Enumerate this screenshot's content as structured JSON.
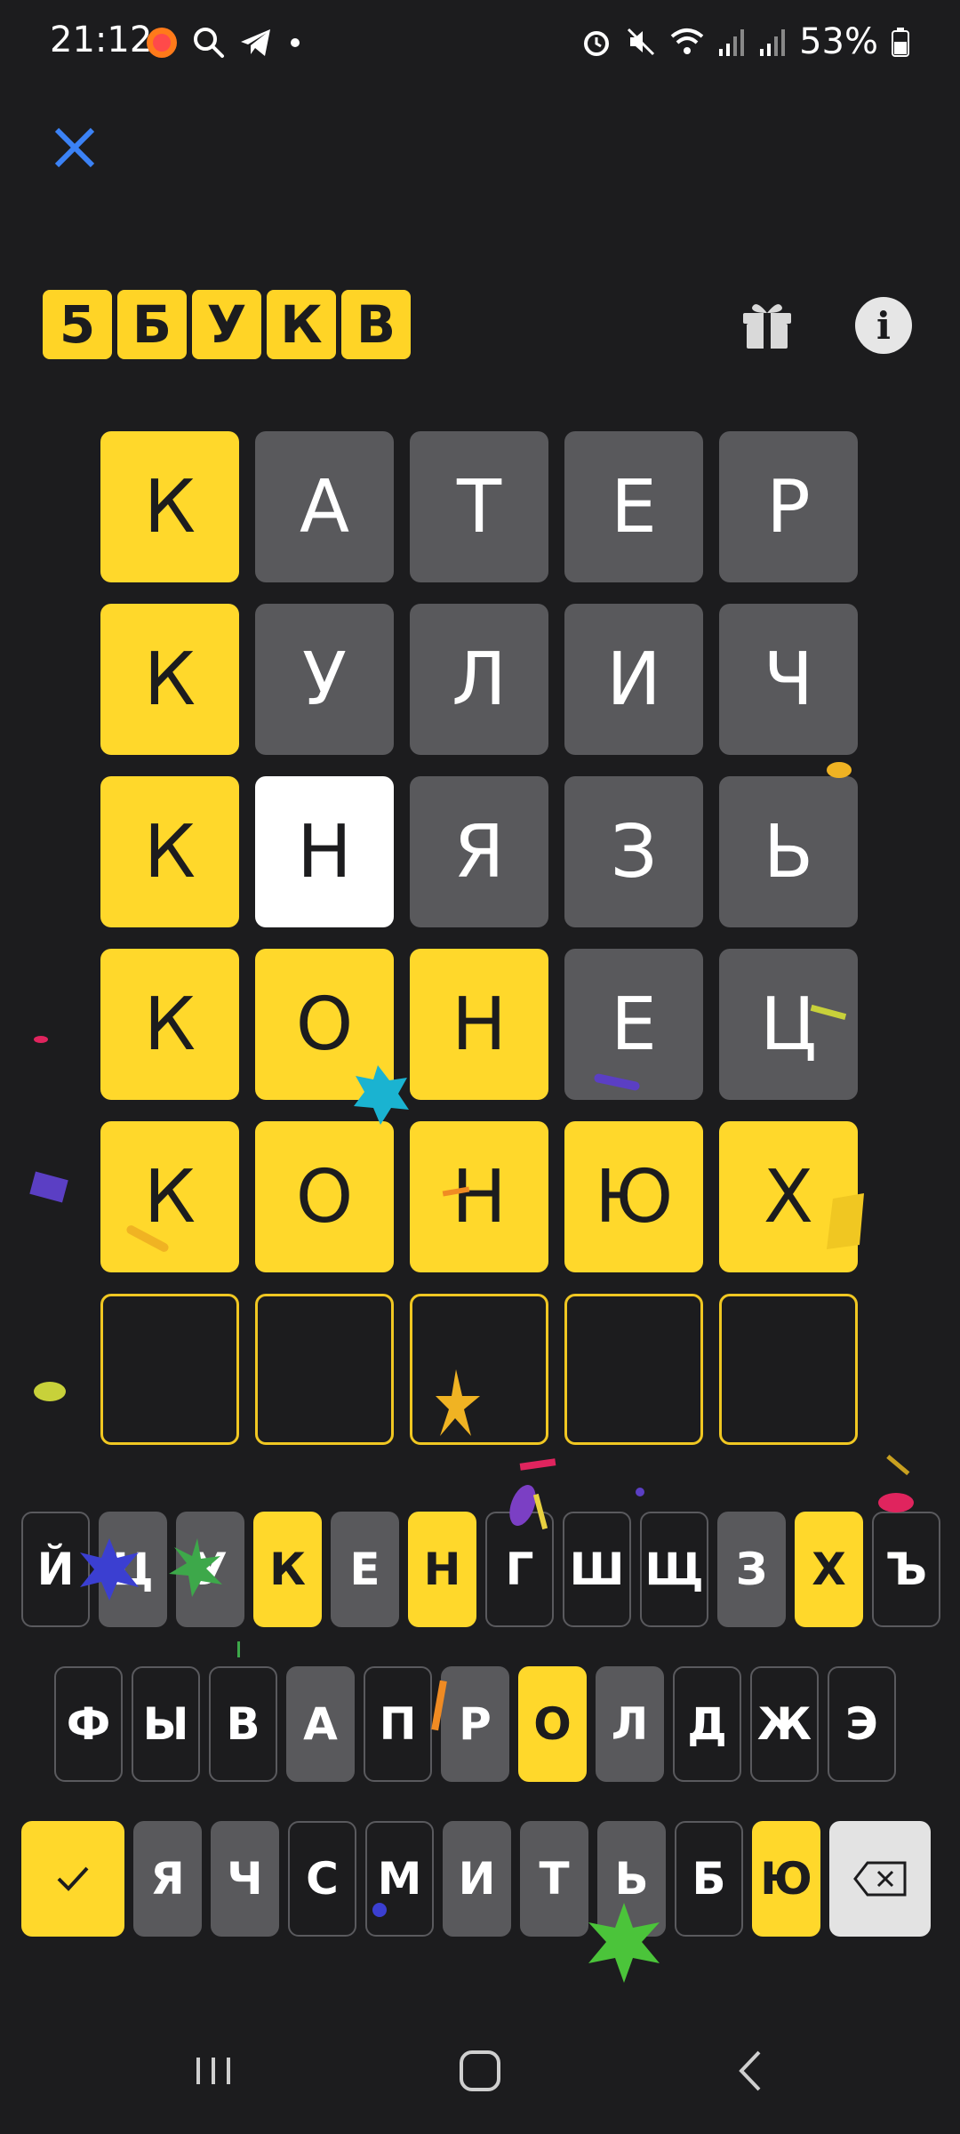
{
  "status_bar": {
    "time": "21:12",
    "battery": "53%"
  },
  "logo": {
    "letters": [
      "5",
      "Б",
      "У",
      "К",
      "В"
    ]
  },
  "board": {
    "rows": [
      [
        {
          "letter": "К",
          "state": "yellow"
        },
        {
          "letter": "А",
          "state": "gray"
        },
        {
          "letter": "Т",
          "state": "gray"
        },
        {
          "letter": "Е",
          "state": "gray"
        },
        {
          "letter": "Р",
          "state": "gray"
        }
      ],
      [
        {
          "letter": "К",
          "state": "yellow"
        },
        {
          "letter": "У",
          "state": "gray"
        },
        {
          "letter": "Л",
          "state": "gray"
        },
        {
          "letter": "И",
          "state": "gray"
        },
        {
          "letter": "Ч",
          "state": "gray"
        }
      ],
      [
        {
          "letter": "К",
          "state": "yellow"
        },
        {
          "letter": "Н",
          "state": "white"
        },
        {
          "letter": "Я",
          "state": "gray"
        },
        {
          "letter": "З",
          "state": "gray"
        },
        {
          "letter": "Ь",
          "state": "gray"
        }
      ],
      [
        {
          "letter": "К",
          "state": "yellow"
        },
        {
          "letter": "О",
          "state": "yellow"
        },
        {
          "letter": "Н",
          "state": "yellow"
        },
        {
          "letter": "Е",
          "state": "gray"
        },
        {
          "letter": "Ц",
          "state": "gray"
        }
      ],
      [
        {
          "letter": "К",
          "state": "yellow"
        },
        {
          "letter": "О",
          "state": "yellow"
        },
        {
          "letter": "Н",
          "state": "yellow"
        },
        {
          "letter": "Ю",
          "state": "yellow"
        },
        {
          "letter": "Х",
          "state": "yellow"
        }
      ],
      [
        {
          "letter": "",
          "state": "empty"
        },
        {
          "letter": "",
          "state": "empty"
        },
        {
          "letter": "",
          "state": "empty"
        },
        {
          "letter": "",
          "state": "empty"
        },
        {
          "letter": "",
          "state": "empty"
        }
      ]
    ]
  },
  "keyboard": {
    "row1": [
      {
        "label": "Й",
        "state": "none"
      },
      {
        "label": "Ц",
        "state": "gray"
      },
      {
        "label": "У",
        "state": "gray"
      },
      {
        "label": "К",
        "state": "yellow"
      },
      {
        "label": "Е",
        "state": "gray"
      },
      {
        "label": "Н",
        "state": "yellow"
      },
      {
        "label": "Г",
        "state": "none"
      },
      {
        "label": "Ш",
        "state": "none"
      },
      {
        "label": "Щ",
        "state": "none"
      },
      {
        "label": "З",
        "state": "gray"
      },
      {
        "label": "Х",
        "state": "yellow"
      },
      {
        "label": "Ъ",
        "state": "none"
      }
    ],
    "row2": [
      {
        "label": "Ф",
        "state": "none"
      },
      {
        "label": "Ы",
        "state": "none"
      },
      {
        "label": "В",
        "state": "none"
      },
      {
        "label": "А",
        "state": "gray"
      },
      {
        "label": "П",
        "state": "none"
      },
      {
        "label": "Р",
        "state": "gray"
      },
      {
        "label": "О",
        "state": "yellow"
      },
      {
        "label": "Л",
        "state": "gray"
      },
      {
        "label": "Д",
        "state": "none"
      },
      {
        "label": "Ж",
        "state": "none"
      },
      {
        "label": "Э",
        "state": "none"
      }
    ],
    "row3": [
      {
        "label": "Я",
        "state": "gray"
      },
      {
        "label": "Ч",
        "state": "gray"
      },
      {
        "label": "С",
        "state": "none"
      },
      {
        "label": "М",
        "state": "none"
      },
      {
        "label": "И",
        "state": "gray"
      },
      {
        "label": "Т",
        "state": "gray"
      },
      {
        "label": "Ь",
        "state": "gray"
      },
      {
        "label": "Б",
        "state": "none"
      },
      {
        "label": "Ю",
        "state": "yellow"
      }
    ],
    "enter_icon": "check-icon",
    "backspace_icon": "backspace-icon"
  },
  "colors": {
    "background": "#1c1c1e",
    "yellow": "#ffd82b",
    "gray": "#59595c",
    "accent_blue": "#3b82f6"
  }
}
